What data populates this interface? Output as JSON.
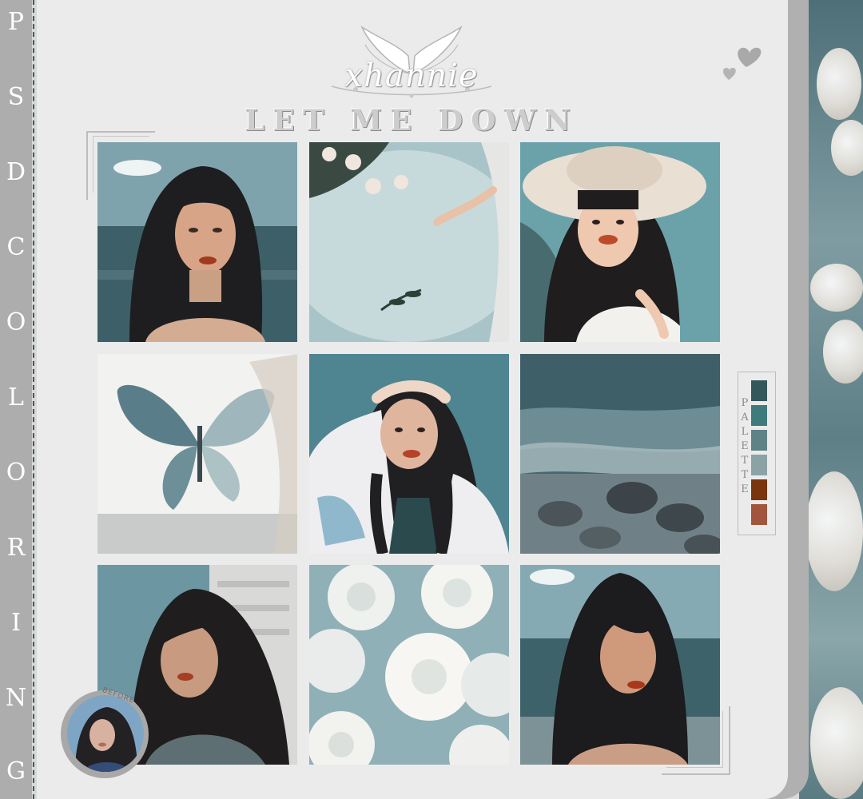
{
  "side_text": [
    "P",
    "S",
    "D",
    "C",
    "O",
    "L",
    "O",
    "R",
    "I",
    "N",
    "G"
  ],
  "logo": {
    "text": "xhannie",
    "icon": "angel-wings-icon"
  },
  "title": "LET ME DOWN",
  "hearts_icon": "hearts-icon",
  "photos": [
    {
      "subject": "woman-by-sea-1"
    },
    {
      "subject": "flowers-in-water"
    },
    {
      "subject": "woman-in-straw-hat"
    },
    {
      "subject": "butterfly-painting"
    },
    {
      "subject": "woman-shading-eyes"
    },
    {
      "subject": "ocean-shore-rocks"
    },
    {
      "subject": "woman-windblown-hair"
    },
    {
      "subject": "white-roses"
    },
    {
      "subject": "woman-by-sea-2"
    }
  ],
  "palette": {
    "label": [
      "P",
      "A",
      "L",
      "E",
      "T",
      "T",
      "E"
    ],
    "colors": [
      "#34575c",
      "#3f7b7c",
      "#5f8287",
      "#8ba3a5",
      "#7a3410",
      "#a1553c"
    ]
  },
  "before": {
    "label": "BEFORE"
  }
}
